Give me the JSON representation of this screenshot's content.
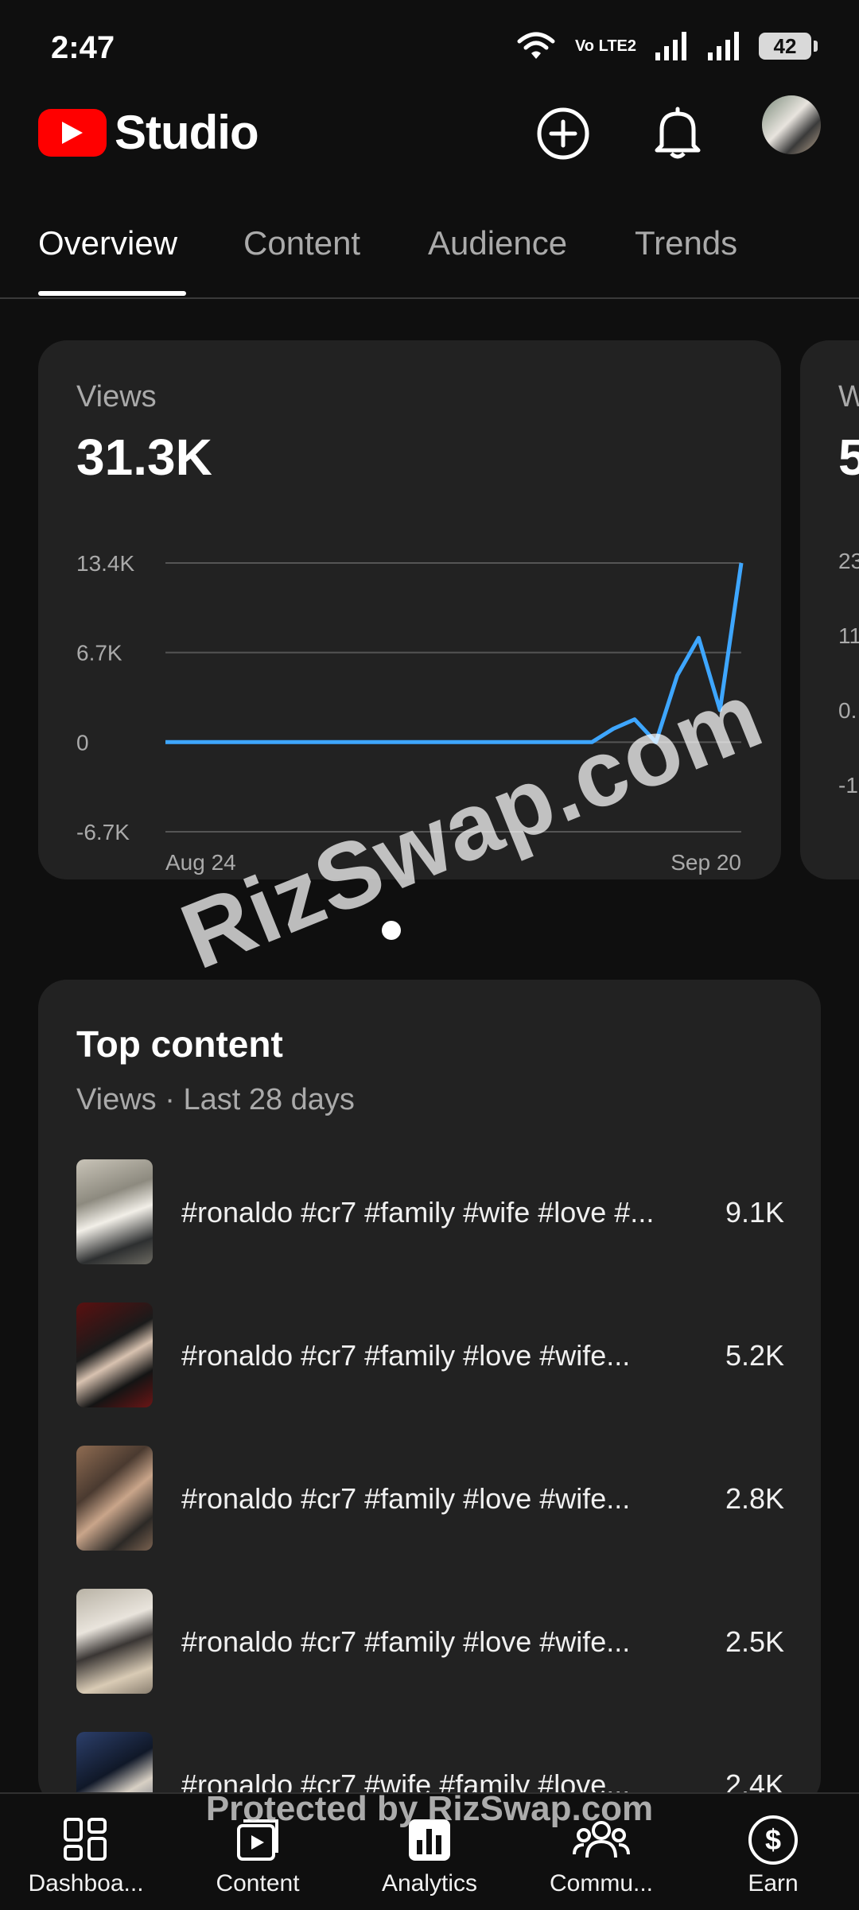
{
  "status_bar": {
    "time": "2:47",
    "network_label": "Vo LTE2",
    "battery": "42"
  },
  "header": {
    "app_title": "Studio",
    "create_icon": "add-circle-icon",
    "notifications_icon": "bell-icon"
  },
  "tabs": [
    {
      "label": "Overview",
      "active": true
    },
    {
      "label": "Content",
      "active": false
    },
    {
      "label": "Audience",
      "active": false
    },
    {
      "label": "Trends",
      "active": false
    }
  ],
  "views_card": {
    "label": "Views",
    "value": "31.3K",
    "y_ticks": [
      "13.4K",
      "6.7K",
      "0",
      "-6.7K"
    ],
    "x_labels": [
      "Aug 24",
      "Sep 20"
    ]
  },
  "chart_data": {
    "type": "line",
    "title": "Views",
    "x_start": "Aug 24",
    "x_end": "Sep 20",
    "ylim": [
      -6700,
      13400
    ],
    "y_ticks": [
      13400,
      6700,
      0,
      -6700
    ],
    "grid": true,
    "series": [
      {
        "color": "#3ea6ff",
        "values": [
          0,
          0,
          0,
          0,
          0,
          0,
          0,
          0,
          0,
          0,
          0,
          0,
          0,
          0,
          0,
          0,
          0,
          0,
          0,
          0,
          0,
          1000,
          1700,
          0,
          5000,
          7800,
          2400,
          13400
        ]
      }
    ]
  },
  "peek_card": {
    "label": "W",
    "value": "5",
    "ticks": [
      "23",
      "11.",
      "0.",
      "-1"
    ]
  },
  "top_content": {
    "title": "Top content",
    "subtitle": "Views · Last 28 days",
    "items": [
      {
        "title": "#ronaldo #cr7 #family #wife #love #...",
        "views": "9.1K"
      },
      {
        "title": "#ronaldo #cr7 #family #love #wife...",
        "views": "5.2K"
      },
      {
        "title": "#ronaldo #cr7 #family #love #wife...",
        "views": "2.8K"
      },
      {
        "title": "#ronaldo #cr7 #family #love #wife...",
        "views": "2.5K"
      },
      {
        "title": "#ronaldo #cr7 #wife #family #love...",
        "views": "2.4K"
      }
    ]
  },
  "watermark": {
    "main": "RizSwap.com",
    "footer": "Protected by RizSwap.com"
  },
  "bottom_nav": [
    {
      "label": "Dashboa...",
      "icon": "dashboard-icon"
    },
    {
      "label": "Content",
      "icon": "content-icon"
    },
    {
      "label": "Analytics",
      "icon": "analytics-icon",
      "active": true
    },
    {
      "label": "Commu...",
      "icon": "community-icon"
    },
    {
      "label": "Earn",
      "icon": "earn-icon"
    }
  ]
}
